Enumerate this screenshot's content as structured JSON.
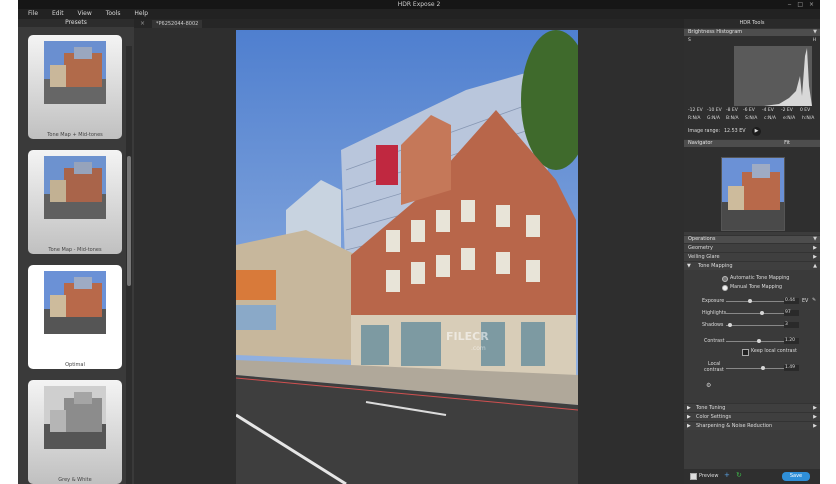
{
  "window": {
    "title": "HDR Expose 2"
  },
  "menu": [
    "File",
    "Edit",
    "View",
    "Tools",
    "Help"
  ],
  "presets": {
    "header": "Presets",
    "items": [
      {
        "label": "Tone Map + Mid-tones"
      },
      {
        "label": "Tone Map - Mid-tones"
      },
      {
        "label": "Optimal"
      },
      {
        "label": "Grey & White"
      }
    ],
    "selected_index": 2
  },
  "document_tab": "*P6252044-8002",
  "watermark": {
    "main": "FILECR",
    "sub": ".com"
  },
  "right_panel": {
    "title": "HDR Tools",
    "histogram": {
      "title": "Brightness Histogram",
      "axis_left": "S",
      "axis_right": "H",
      "ev_labels": [
        "-12 EV",
        "-10 EV",
        "-8 EV",
        "-6 EV",
        "-4 EV",
        "-2 EV",
        "0 EV"
      ],
      "channel_labels": [
        "R:N/A",
        "G:N/A",
        "B:N/A",
        "S:N/A",
        "c:N/A",
        "e:N/A",
        "h:N/A"
      ],
      "image_range_label": "Image range:",
      "image_range_value": "12.53 EV"
    },
    "navigator": {
      "title": "Navigator",
      "fit": "Fit"
    },
    "operations": {
      "title": "Operations",
      "sections": [
        "Geometry",
        "Veiling Glare",
        "Tone Mapping"
      ]
    },
    "tone_mapping": {
      "auto_label": "Automatic Tone Mapping",
      "manual_label": "Manual Tone Mapping",
      "mode": "manual",
      "exposure": {
        "label": "Exposure",
        "value": "0.44",
        "unit": "EV",
        "pos": 0.4
      },
      "highlights": {
        "label": "Highlights",
        "value": "97",
        "pos": 0.6
      },
      "shadows": {
        "label": "Shadows",
        "value": "3",
        "pos": 0.03
      },
      "contrast": {
        "label": "Contrast",
        "value": "1.20",
        "pos": 0.55
      },
      "keep_local_label": "Keep local contrast",
      "local_contrast": {
        "label1": "Local",
        "label2": "contrast",
        "value": "1.49",
        "pos": 0.62
      }
    },
    "more_sections": [
      "Tone Tuning",
      "Color Settings",
      "Sharpening & Noise Reduction"
    ],
    "preview_label": "Preview",
    "save_label": "Save"
  }
}
